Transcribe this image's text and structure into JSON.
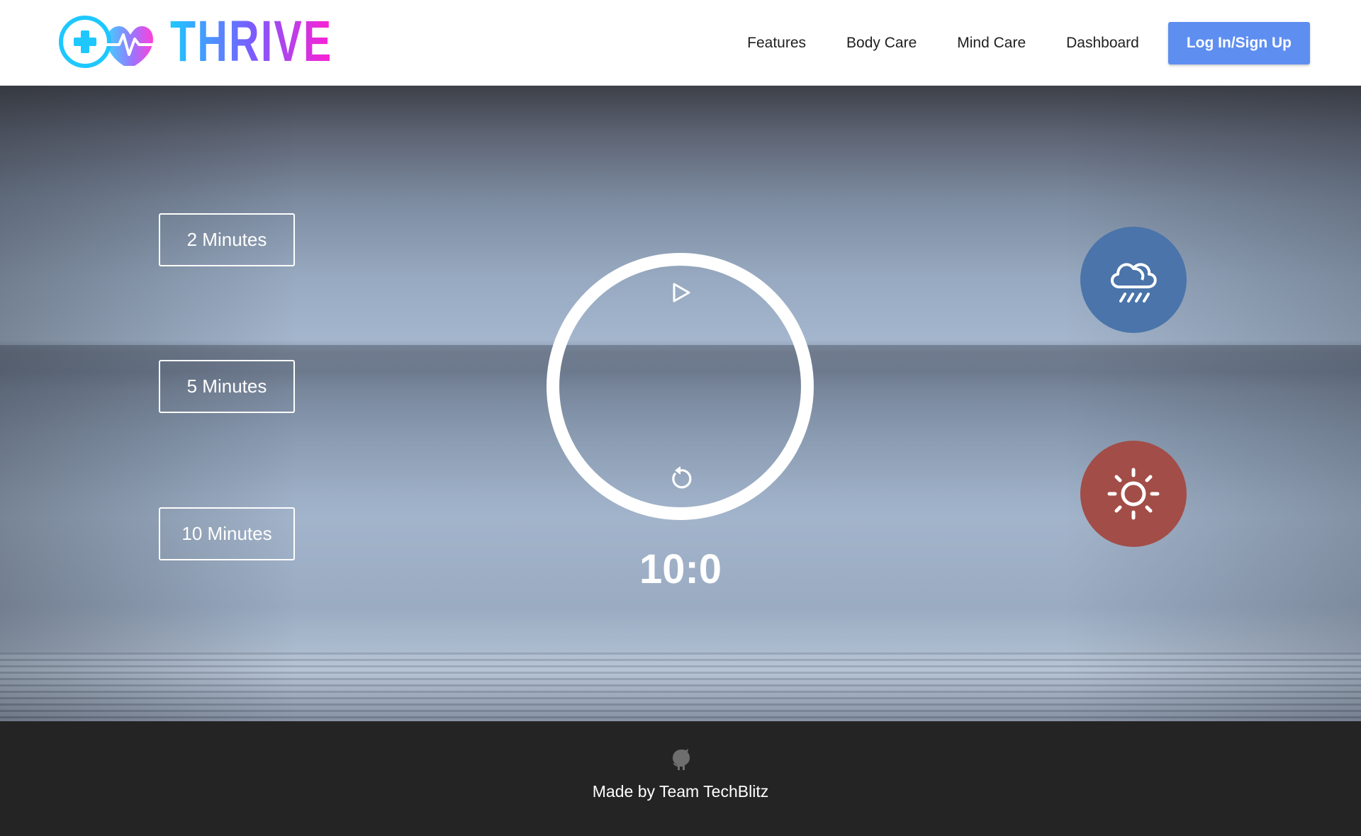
{
  "brand": {
    "name": "THRIVE",
    "logo_icon": "medical-cross-heart-pulse-icon"
  },
  "nav": {
    "links": [
      "Features",
      "Body Care",
      "Mind Care",
      "Dashboard"
    ],
    "login_label": "Log In/Sign Up"
  },
  "durations": [
    "2 Minutes",
    "5 Minutes",
    "10 Minutes"
  ],
  "timer": {
    "display": "10:0",
    "play_icon": "play-icon",
    "replay_icon": "replay-icon"
  },
  "sounds": [
    {
      "name": "rain",
      "icon": "cloud-rain-icon",
      "color": "#4a74aa"
    },
    {
      "name": "sun",
      "icon": "sun-icon",
      "color": "#a24d47"
    }
  ],
  "colors": {
    "login_button": "#5e8ef0",
    "footer_bg": "#242424"
  },
  "footer": {
    "icon": "github-icon",
    "credit": "Made by Team TechBlitz"
  }
}
